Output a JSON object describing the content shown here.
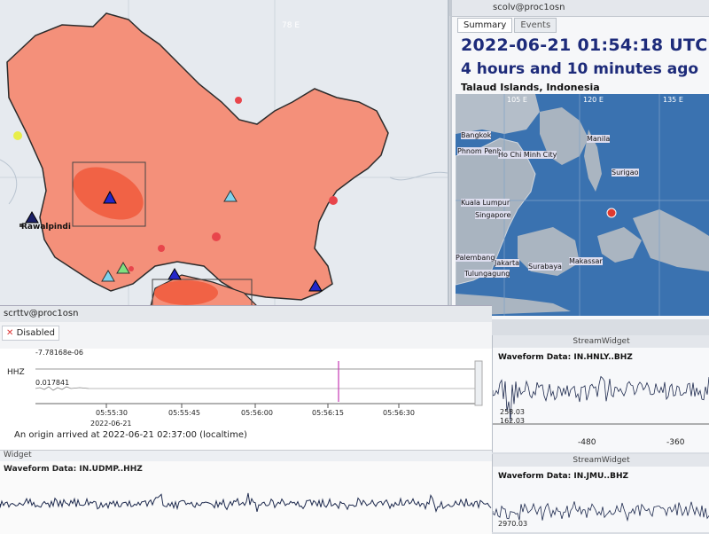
{
  "map_window": {
    "lon_tick": "78 E",
    "station_label": "Rawalpindi"
  },
  "right_panel": {
    "titlebar": "scolv@proc1osn",
    "tabs": [
      "Summary",
      "Events"
    ],
    "time": "2022-06-21 01:54:18 UTC",
    "ago": "4 hours and 10 minutes ago",
    "region": "Talaud Islands, Indonesia",
    "minimap": {
      "lon_ticks": [
        "105 E",
        "120 E",
        "135 E"
      ],
      "places": [
        "Bangkok",
        "Phnom Penh",
        "Ho Chi Minh City",
        "Manila",
        "Surigao",
        "Kuala Lumpur",
        "Singapore",
        "Palembang",
        "Jakarta",
        "Surabaya",
        "Makassar",
        "Tulungagung"
      ]
    }
  },
  "trace_window": {
    "titlebar": "scrttv@proc1osn",
    "disabled_label": "Disabled",
    "max_value": "-7.78168e-06",
    "channel": "HHZ",
    "min_value": "0.017841",
    "time_ticks": [
      "05:55:30",
      "05:55:45",
      "05:56:00",
      "05:56:15",
      "05:56:30"
    ],
    "date": "2022-06-21",
    "origin_text": "An origin arrived at 2022-06-21 02:37:00 (localtime)",
    "lower_widget_title": "Widget",
    "lower_label": "Waveform Data: IN.UDMP..HHZ"
  },
  "stream1": {
    "title": "StreamWidget",
    "label": "Waveform Data: IN.HNLY..BHZ",
    "ticks": [
      "-480",
      "-360"
    ],
    "value1": "258.03",
    "value2": "162.03"
  },
  "stream2": {
    "title": "StreamWidget",
    "label": "Waveform Data: IN.JMU..BHZ",
    "value1": "2970.03"
  }
}
